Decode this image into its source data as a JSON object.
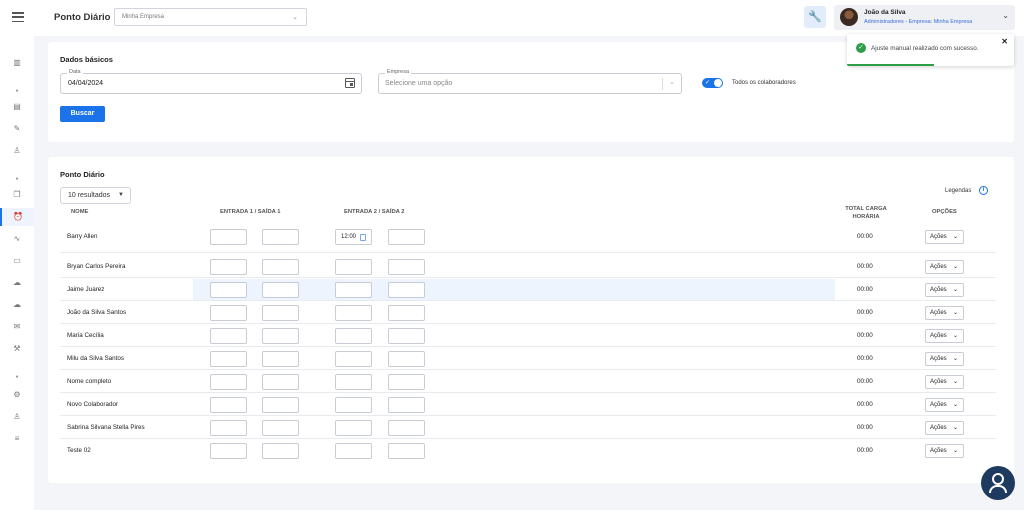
{
  "header": {
    "app_title": "Ponto Diário",
    "company_select_value": "Minha Empresa",
    "user": {
      "name": "João da Silva",
      "role": "Administradores - Empresa: Minha Empresa"
    }
  },
  "sidebar": {
    "items": [
      {
        "icon": "bar-chart-icon",
        "glyph": "▥"
      },
      {
        "icon": "dot-separator",
        "glyph": "●"
      },
      {
        "icon": "document-icon",
        "glyph": "▤"
      },
      {
        "icon": "pen-icon",
        "glyph": "✎"
      },
      {
        "icon": "person-icon",
        "glyph": "♙"
      },
      {
        "icon": "dot-separator",
        "glyph": "●"
      },
      {
        "icon": "copy-icon",
        "glyph": "❐"
      },
      {
        "icon": "alarm-clock-icon",
        "glyph": "⏰"
      },
      {
        "icon": "trend-icon",
        "glyph": "∿"
      },
      {
        "icon": "chat-icon",
        "glyph": "▭"
      },
      {
        "icon": "cloud-upload-icon",
        "glyph": "☁"
      },
      {
        "icon": "cloud-download-icon",
        "glyph": "☁"
      },
      {
        "icon": "mail-icon",
        "glyph": "✉"
      },
      {
        "icon": "wrench-icon",
        "glyph": "⚒"
      },
      {
        "icon": "dot-separator",
        "glyph": "●"
      },
      {
        "icon": "gear-icon",
        "glyph": "⚙"
      },
      {
        "icon": "user-icon",
        "glyph": "♙"
      },
      {
        "icon": "list-icon",
        "glyph": "≡"
      }
    ]
  },
  "basics": {
    "title": "Dados básicos",
    "date_label": "Data",
    "date_value": "04/04/2024",
    "empresa_label": "Empresa",
    "empresa_placeholder": "Selecione uma opção",
    "toggle_label": "Todos os colaboradores",
    "toggle_on": true,
    "search_button": "Buscar"
  },
  "ponto": {
    "title": "Ponto Diário",
    "results_select": "10 resultados",
    "legend_link": "Legendas",
    "columns": {
      "nome": "NOME",
      "es1": "ENTRADA 1 / SAÍDA 1",
      "es2": "ENTRADA 2 / SAÍDA 2",
      "total_line1": "TOTAL CARGA",
      "total_line2": "HORÁRIA",
      "opcoes": "OPÇÕES"
    },
    "action_label": "Ações",
    "rows": [
      {
        "name": "Barry Allen",
        "e1": "",
        "s1": "",
        "e2": "12:00",
        "s2": "",
        "total": "00:00"
      },
      {
        "name": "Bryan Carlos Pereira",
        "e1": "",
        "s1": "",
        "e2": "",
        "s2": "",
        "total": "00:00"
      },
      {
        "name": "Jaime Juarez",
        "e1": "",
        "s1": "",
        "e2": "",
        "s2": "",
        "total": "00:00"
      },
      {
        "name": "João da Silva Santos",
        "e1": "",
        "s1": "",
        "e2": "",
        "s2": "",
        "total": "00:00"
      },
      {
        "name": "Maria Cecília",
        "e1": "",
        "s1": "",
        "e2": "",
        "s2": "",
        "total": "00:00"
      },
      {
        "name": "Milu da Silva Santos",
        "e1": "",
        "s1": "",
        "e2": "",
        "s2": "",
        "total": "00:00"
      },
      {
        "name": "Nome completo",
        "e1": "",
        "s1": "",
        "e2": "",
        "s2": "",
        "total": "00:00"
      },
      {
        "name": "Novo Colaborador",
        "e1": "",
        "s1": "",
        "e2": "",
        "s2": "",
        "total": "00:00"
      },
      {
        "name": "Sabrina Silvana Stella Pires",
        "e1": "",
        "s1": "",
        "e2": "",
        "s2": "",
        "total": "00:00"
      },
      {
        "name": "Teste 02",
        "e1": "",
        "s1": "",
        "e2": "",
        "s2": "",
        "total": "00:00"
      }
    ]
  },
  "toast": {
    "message": "Ajuste manual realizado com sucesso.",
    "progress": 0.52,
    "color": "#2e9e48"
  },
  "colors": {
    "accent": "#1a73e8",
    "fab": "#1e3a5f"
  }
}
